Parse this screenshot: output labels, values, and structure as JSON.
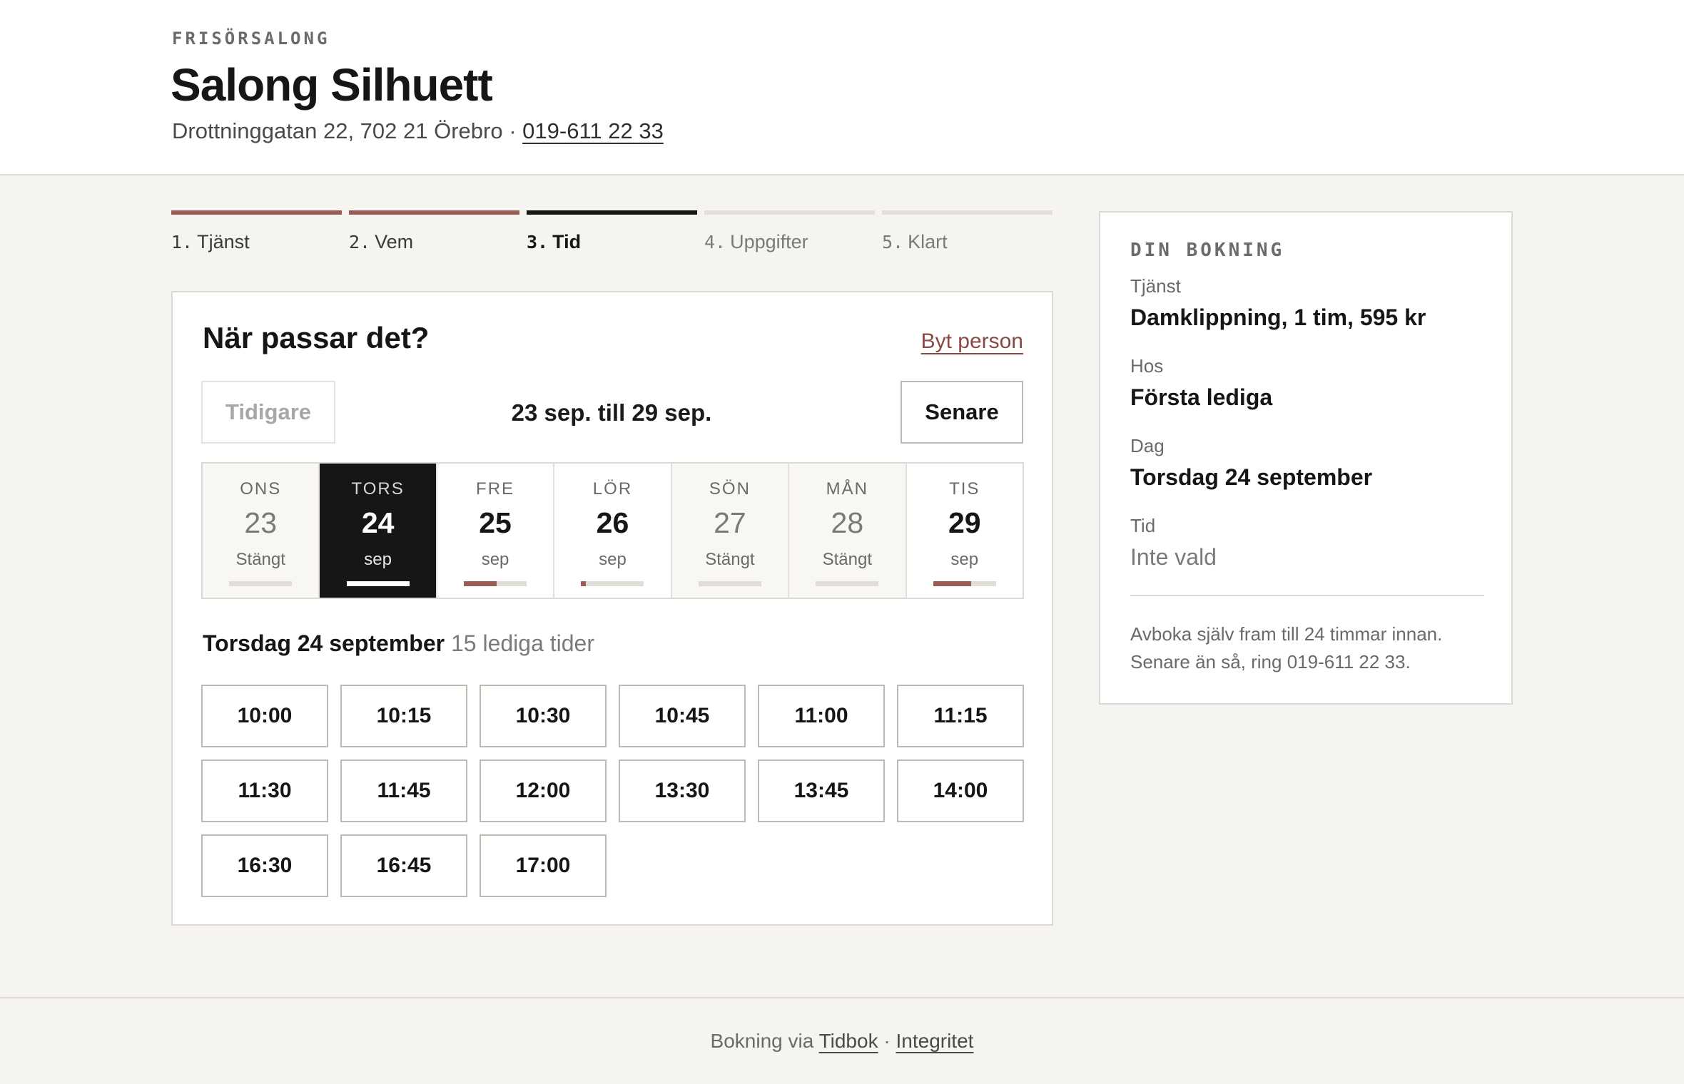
{
  "header": {
    "eyebrow": "FRISÖRSALONG",
    "title": "Salong Silhuett",
    "address": "Drottninggatan 22, 702 21 Örebro · ",
    "phone": "019-611 22 33"
  },
  "steps": [
    {
      "num": "1.",
      "label": "Tjänst",
      "state": "done"
    },
    {
      "num": "2.",
      "label": "Vem",
      "state": "done"
    },
    {
      "num": "3.",
      "label": "Tid",
      "state": "active"
    },
    {
      "num": "4.",
      "label": "Uppgifter",
      "state": "todo"
    },
    {
      "num": "5.",
      "label": "Klart",
      "state": "todo"
    }
  ],
  "booking": {
    "title": "När passar det?",
    "change_person": "Byt person",
    "prev_label": "Tidigare",
    "next_label": "Senare",
    "range": "23 sep. till 29 sep.",
    "days": [
      {
        "name": "ONS",
        "num": "23",
        "sub": "Stängt",
        "closed": true,
        "availability": 0
      },
      {
        "name": "TORS",
        "num": "24",
        "sub": "sep",
        "closed": false,
        "selected": true,
        "availability": 1.0
      },
      {
        "name": "FRE",
        "num": "25",
        "sub": "sep",
        "closed": false,
        "availability": 0.52
      },
      {
        "name": "LÖR",
        "num": "26",
        "sub": "sep",
        "closed": false,
        "availability": 0.07
      },
      {
        "name": "SÖN",
        "num": "27",
        "sub": "Stängt",
        "closed": true,
        "availability": 0
      },
      {
        "name": "MÅN",
        "num": "28",
        "sub": "Stängt",
        "closed": true,
        "availability": 0
      },
      {
        "name": "TIS",
        "num": "29",
        "sub": "sep",
        "closed": false,
        "availability": 0.6
      }
    ],
    "slots_date": "Torsdag 24 september",
    "slots_count": "15 lediga tider",
    "slots": [
      "10:00",
      "10:15",
      "10:30",
      "10:45",
      "11:00",
      "11:15",
      "11:30",
      "11:45",
      "12:00",
      "13:30",
      "13:45",
      "14:00",
      "16:30",
      "16:45",
      "17:00"
    ]
  },
  "summary": {
    "title": "DIN BOKNING",
    "service_label": "Tjänst",
    "service_value": "Damklippning, 1 tim, 595 kr",
    "with_label": "Hos",
    "with_value": "Första lediga",
    "day_label": "Dag",
    "day_value": "Torsdag 24 september",
    "time_label": "Tid",
    "time_value": "Inte vald",
    "note": "Avboka själv fram till 24 timmar innan. Senare än så, ring 019-611 22 33."
  },
  "footer": {
    "prefix": "Bokning via ",
    "tidbok": "Tidbok",
    "sep": " · ",
    "privacy": "Integritet"
  },
  "colors": {
    "accent": "#9b5c55",
    "link": "#8a4a44",
    "ink": "#161616",
    "page_bg": "#f5f4f0"
  }
}
